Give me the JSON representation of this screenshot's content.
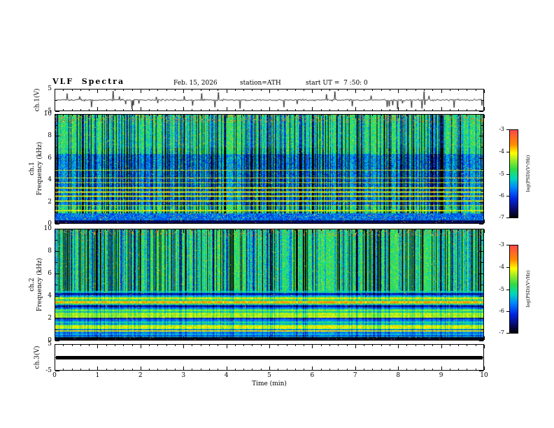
{
  "header": {
    "title": "VLF  Spectra",
    "date": "Feb. 15, 2026",
    "station": "station=ATH",
    "start_ut": "start UT =  7 :50: 0"
  },
  "xaxis": {
    "label": "Time (min)",
    "range": [
      0,
      10
    ],
    "ticks": [
      0,
      1,
      2,
      3,
      4,
      5,
      6,
      7,
      8,
      9,
      10
    ]
  },
  "colorbar": {
    "label": "log(PSD)(V²/Hz)",
    "range": [
      -7,
      -3
    ],
    "ticks": [
      -3,
      -4,
      -5,
      -6,
      -7
    ]
  },
  "chart_data": [
    {
      "type": "line",
      "name": "ch1-voltage-waveform",
      "ylabel": "ch.1(V)",
      "ylim": [
        -5,
        5
      ],
      "yticks": [
        5,
        -5
      ],
      "series_description": "broadband noise near 0 V with dense impulsive sferic spikes reaching about +/-5 V over the full 10 minute record"
    },
    {
      "type": "heatmap",
      "name": "ch1-spectrogram",
      "ylabel_lines": [
        "ch.1",
        "Frequency (kHz)"
      ],
      "ylim": [
        0,
        10
      ],
      "yticks": [
        0,
        2,
        4,
        6,
        8,
        10
      ],
      "zlabel": "log(PSD)(V²/Hz)",
      "zlim": [
        -7,
        -3
      ],
      "description": "green broadband field near -5 with dense vertical dark-blue dropout streaks (strongest 2-6 kHz), bright horizontal tuning lines between 1 and 4.5 kHz, near-black band below 0.5 kHz, sporadic red impulses near -3 around 9-10 kHz"
    },
    {
      "type": "heatmap",
      "name": "ch2-spectrogram",
      "ylabel_lines": [
        "ch.2",
        "Frequency (kHz)"
      ],
      "ylim": [
        0,
        10
      ],
      "yticks": [
        0,
        2,
        4,
        6,
        8,
        10
      ],
      "zlabel": "log(PSD)(V²/Hz)",
      "zlim": [
        -7,
        -3
      ],
      "description": "green field with strong vertical dark-blue dropouts above 4.5 kHz; horizontally banded green/cyan/yellow structure below 4.5 kHz with a bright yellow line near 3.4 kHz and a near-black band below 0.3 kHz"
    },
    {
      "type": "line",
      "name": "ch3-voltage-waveform",
      "ylabel": "ch.3(V)",
      "ylim": [
        -5,
        5
      ],
      "yticks": [
        5,
        -5
      ],
      "series_description": "flat trace drawn as a thick black horizontal line at about 0 V for the whole record"
    }
  ]
}
